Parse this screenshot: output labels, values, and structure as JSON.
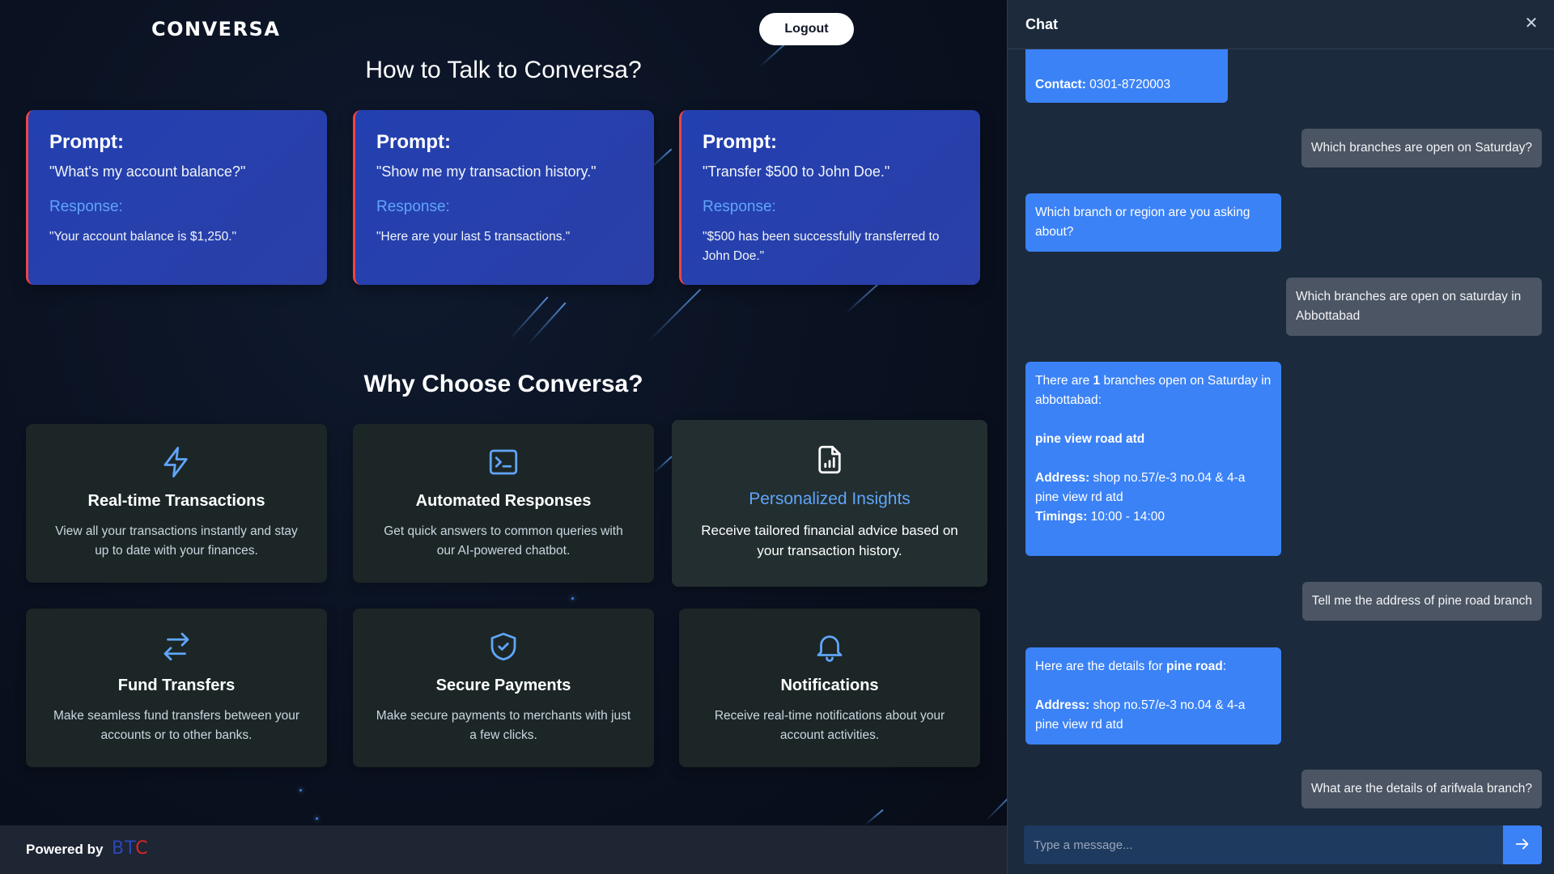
{
  "brand": "CONVERSA",
  "logout_label": "Logout",
  "how_title": "How to Talk to Conversa?",
  "prompt_cards": [
    {
      "prompt_label": "Prompt:",
      "prompt": "\"What's my account balance?\"",
      "response_label": "Response:",
      "response": "\"Your account balance is $1,250.\""
    },
    {
      "prompt_label": "Prompt:",
      "prompt": "\"Show me my transaction history.\"",
      "response_label": "Response:",
      "response": "\"Here are your last 5 transactions.\""
    },
    {
      "prompt_label": "Prompt:",
      "prompt": "\"Transfer $500 to John Doe.\"",
      "response_label": "Response:",
      "response": "\"$500 has been successfully transferred to John Doe.\""
    }
  ],
  "why_title": "Why Choose Conversa?",
  "features": [
    {
      "icon": "lightning-icon",
      "title": "Real-time Transactions",
      "desc": "View all your transactions instantly and stay up to date with your finances."
    },
    {
      "icon": "terminal-icon",
      "title": "Automated Responses",
      "desc": "Get quick answers to common queries with our AI-powered chatbot."
    },
    {
      "icon": "document-chart-icon",
      "title": "Personalized Insights",
      "desc": "Receive tailored financial advice based on your transaction history."
    },
    {
      "icon": "arrows-exchange-icon",
      "title": "Fund Transfers",
      "desc": "Make seamless fund transfers between your accounts or to other banks."
    },
    {
      "icon": "shield-check-icon",
      "title": "Secure Payments",
      "desc": "Make secure payments to merchants with just a few clicks."
    },
    {
      "icon": "bell-icon",
      "title": "Notifications",
      "desc": "Receive real-time notifications about your account activities."
    }
  ],
  "footer": {
    "powered_by": "Powered by",
    "logo": "BTC"
  },
  "chat": {
    "title": "Chat",
    "close_icon": "close-icon",
    "messages": [
      {
        "from": "bot",
        "contact_label": "Contact:",
        "contact_value": "0301-8720003"
      },
      {
        "from": "user",
        "text": "Which branches are open on Saturday?"
      },
      {
        "from": "bot",
        "text": "Which branch or region are you asking about?"
      },
      {
        "from": "user",
        "text": "Which branches are open on saturday in Abbottabad"
      },
      {
        "from": "bot",
        "count_pre": "There are",
        "count": "1",
        "count_post": "branches open on Saturday in abbottabad:",
        "branch": "pine view road atd",
        "address_label": "Address:",
        "address": "shop no.57/e-3 no.04 & 4-a pine view rd atd",
        "timings_label": "Timings:",
        "timings": "10:00 - 14:00"
      },
      {
        "from": "user",
        "text": "Tell me the address of pine road branch"
      },
      {
        "from": "bot",
        "details_pre": "Here are the details for",
        "details_name": "pine road",
        "details_post": ":",
        "address_label": "Address:",
        "address": "shop no.57/e-3 no.04 & 4-a pine view rd atd"
      },
      {
        "from": "user",
        "text": "What are the details of arifwala branch?"
      }
    ],
    "input_placeholder": "Type a message...",
    "input_value": "",
    "send_icon": "arrow-right-icon"
  },
  "colors": {
    "accent": "#3b82f6",
    "card_blue": "#2340b0",
    "card_border": "#ef4444",
    "feature_bg": "#1c2626",
    "user_bubble": "#4b5563",
    "chat_bg": "#1b2a3d"
  }
}
